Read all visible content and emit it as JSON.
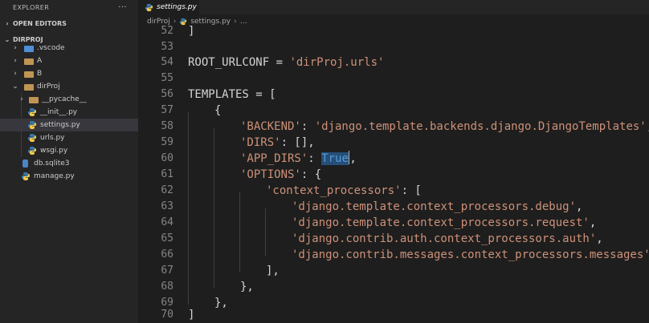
{
  "sidebar": {
    "title": "EXPLORER",
    "more_label": "···",
    "open_editors_label": "OPEN EDITORS",
    "project_label": "DIRPROJ",
    "items": [
      {
        "label": ".vscode",
        "icon": "vscode-folder-icon",
        "expanded": false
      },
      {
        "label": "A",
        "icon": "folder-icon",
        "expanded": false
      },
      {
        "label": "B",
        "icon": "folder-icon",
        "expanded": false
      },
      {
        "label": "dirProj",
        "icon": "folder-open-icon",
        "expanded": true
      },
      {
        "label": "__pycache__",
        "icon": "folder-icon",
        "expanded": false
      },
      {
        "label": "__init__.py",
        "icon": "python-icon"
      },
      {
        "label": "settings.py",
        "icon": "python-icon",
        "active": true
      },
      {
        "label": "urls.py",
        "icon": "python-icon"
      },
      {
        "label": "wsgi.py",
        "icon": "python-icon"
      },
      {
        "label": "db.sqlite3",
        "icon": "database-icon"
      },
      {
        "label": "manage.py",
        "icon": "python-icon"
      }
    ]
  },
  "tab": {
    "label": "settings.py"
  },
  "breadcrumb": {
    "folder": "dirProj",
    "file": "settings.py",
    "more": "…"
  },
  "editor": {
    "line_numbers": [
      "52",
      "53",
      "54",
      "55",
      "56",
      "57",
      "58",
      "59",
      "60",
      "61",
      "62",
      "63",
      "64",
      "65",
      "66",
      "67",
      "68",
      "69",
      "70"
    ],
    "lines": {
      "l52": "]",
      "l54_id": "ROOT_URLCONF = ",
      "l54_str": "'dirProj.urls'",
      "l56": "TEMPLATES = [",
      "l57": "{",
      "l58_key": "'BACKEND'",
      "l58_mid": ": ",
      "l58_val": "'django.template.backends.django.DjangoTemplates'",
      "l58_end": ",",
      "l59_key": "'DIRS'",
      "l59_rest": ": [],",
      "l60_key": "'APP_DIRS'",
      "l60_mid": ": ",
      "l60_val": "True",
      "l60_end": ",",
      "l61_key": "'OPTIONS'",
      "l61_rest": ": {",
      "l62_key": "'context_processors'",
      "l62_rest": ": [",
      "l63_val": "'django.template.context_processors.debug'",
      "l64_val": "'django.template.context_processors.request'",
      "l65_val": "'django.contrib.auth.context_processors.auth'",
      "l66_val": "'django.contrib.messages.context_processors.messages'",
      "comma": ",",
      "l67": "],",
      "l68": "},",
      "l69": "},",
      "l70": "]"
    }
  },
  "colors": {
    "editor_bg": "#1e1e1e",
    "sidebar_bg": "#252526",
    "string": "#ce9178",
    "keyword": "#569cd6",
    "selection": "#264f78"
  }
}
